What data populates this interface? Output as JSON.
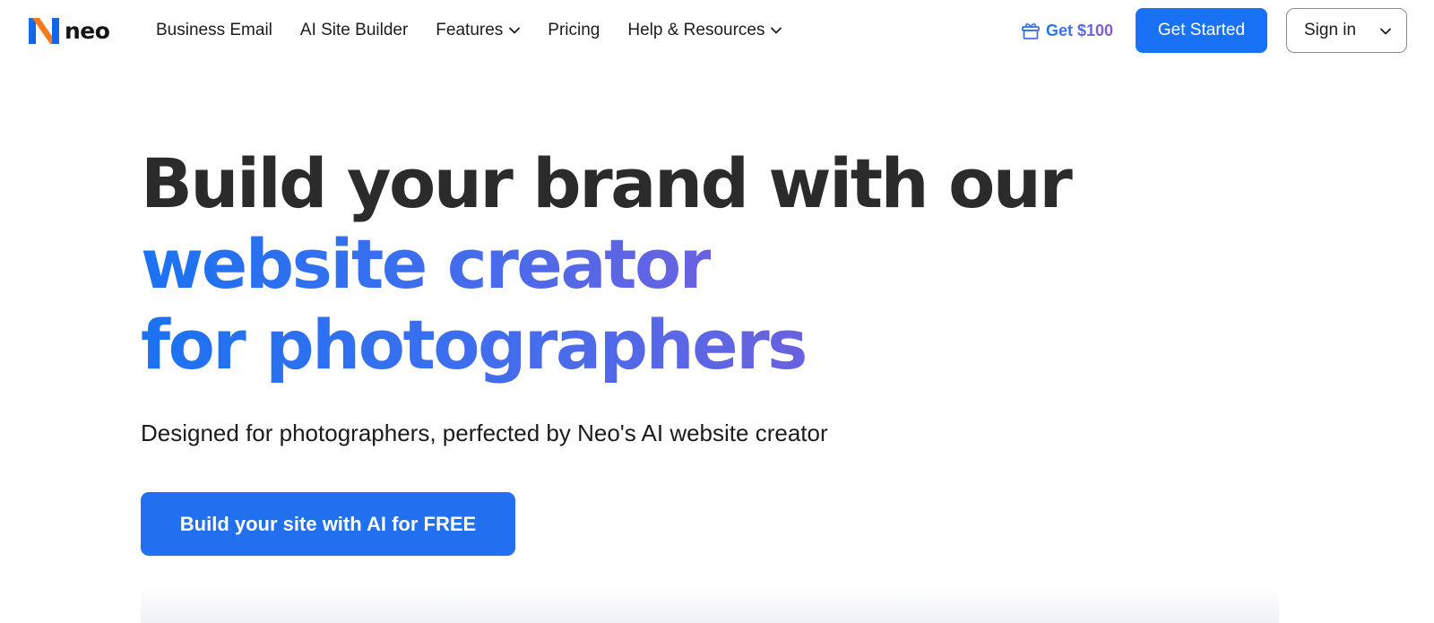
{
  "brand": {
    "name": "neo",
    "colors": {
      "blue": "#1971f5",
      "orange": "#f57a1f",
      "purple": "#8b5ad8"
    }
  },
  "nav": {
    "items": [
      {
        "label": "Business Email",
        "has_dropdown": false
      },
      {
        "label": "AI Site Builder",
        "has_dropdown": false
      },
      {
        "label": "Features",
        "has_dropdown": true
      },
      {
        "label": "Pricing",
        "has_dropdown": false
      },
      {
        "label": "Help & Resources",
        "has_dropdown": true
      }
    ]
  },
  "header_actions": {
    "promo_label": "Get $100",
    "promo_icon": "gift-icon",
    "get_started_label": "Get Started",
    "sign_in_label": "Sign in"
  },
  "hero": {
    "title_line1": "Build your brand with our",
    "title_line2": "website creator",
    "title_line3": "for photographers",
    "subtitle": "Designed for photographers, perfected by Neo's AI website creator",
    "cta_label": "Build your site with AI for FREE"
  }
}
